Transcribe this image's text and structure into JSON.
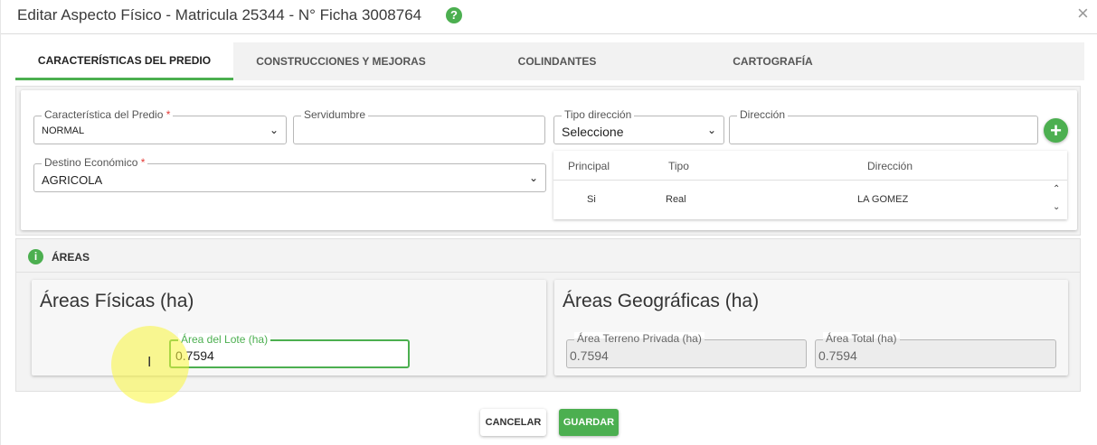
{
  "dialog": {
    "title": "Editar Aspecto Físico - Matricula 25344 - N° Ficha 3008764",
    "help_icon": "?",
    "close_icon": "×"
  },
  "tabs": [
    {
      "label": "CARACTERÍSTICAS DEL PREDIO",
      "active": true
    },
    {
      "label": "CONSTRUCCIONES Y MEJORAS",
      "active": false
    },
    {
      "label": "COLINDANTES",
      "active": false
    },
    {
      "label": "CARTOGRAFÍA",
      "active": false
    }
  ],
  "predio": {
    "caracteristica": {
      "label": "Característica del Predio",
      "required": "*",
      "value": "NORMAL"
    },
    "servidumbre": {
      "label": "Servidumbre",
      "value": ""
    },
    "tipo_direccion": {
      "label": "Tipo dirección",
      "value": "Seleccione"
    },
    "direccion": {
      "label": "Dirección",
      "value": ""
    },
    "destino": {
      "label": "Destino Económico",
      "required": "*",
      "value": "AGRICOLA"
    },
    "add_icon": "+"
  },
  "address_table": {
    "columns": [
      "Principal",
      "Tipo",
      "Dirección"
    ],
    "rows": [
      {
        "principal": "Si",
        "tipo": "Real",
        "direccion": "LA GOMEZ"
      }
    ],
    "scroll_up": "⌃",
    "scroll_down": "⌄"
  },
  "areas": {
    "section_title": "ÁREAS",
    "info_icon": "i",
    "fisicas": {
      "title": "Áreas Físicas (ha)",
      "area_lote": {
        "label": "Área del Lote (ha)",
        "value": "0.7594"
      }
    },
    "geograficas": {
      "title": "Áreas Geográficas (ha)",
      "terreno_privada": {
        "label": "Área Terreno Privada (ha)",
        "value": "0.7594"
      },
      "total": {
        "label": "Área Total (ha)",
        "value": "0.7594"
      }
    }
  },
  "footer": {
    "cancel_label": "CANCELAR",
    "save_label": "GUARDAR"
  },
  "colors": {
    "accent": "#4caf50",
    "required": "#e53935"
  },
  "chevron_glyph": "⌄",
  "text_cursor_glyph": "I"
}
